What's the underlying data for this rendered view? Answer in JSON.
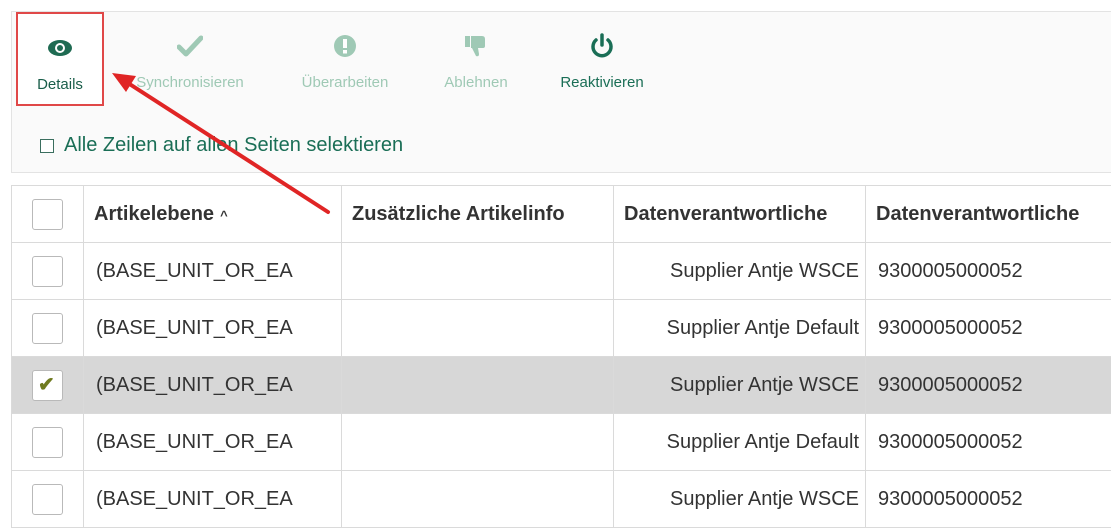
{
  "toolbar": {
    "buttons": [
      {
        "label": "Details",
        "icon": "eye-icon",
        "state": "active"
      },
      {
        "label": "Synchronisieren",
        "icon": "checkmark-icon",
        "state": "disabled"
      },
      {
        "label": "Überarbeiten",
        "icon": "exclamation-icon",
        "state": "disabled"
      },
      {
        "label": "Ablehnen",
        "icon": "thumbs-down-icon",
        "state": "disabled"
      },
      {
        "label": "Reaktivieren",
        "icon": "power-icon",
        "state": "enabled"
      }
    ]
  },
  "select_all": {
    "label": "Alle Zeilen auf allen Seiten selektieren",
    "checked": false
  },
  "table": {
    "headers": [
      "Artikelebene",
      "Zusätzliche Artikelinfo",
      "Datenverantwortliche",
      "Datenverantwortliche"
    ],
    "sort_indicator": "^",
    "rows": [
      {
        "checked": false,
        "cells": [
          "(BASE_UNIT_OR_EA",
          "",
          "Supplier Antje WSCE",
          "9300005000052"
        ]
      },
      {
        "checked": false,
        "cells": [
          "(BASE_UNIT_OR_EA",
          "",
          "Supplier Antje Default",
          "9300005000052"
        ]
      },
      {
        "checked": true,
        "cells": [
          "(BASE_UNIT_OR_EA",
          "",
          "Supplier Antje WSCE",
          "9300005000052"
        ]
      },
      {
        "checked": false,
        "cells": [
          "(BASE_UNIT_OR_EA",
          "",
          "Supplier Antje Default",
          "9300005000052"
        ]
      },
      {
        "checked": false,
        "cells": [
          "(BASE_UNIT_OR_EA",
          "",
          "Supplier Antje WSCE",
          "9300005000052"
        ]
      }
    ]
  },
  "colors": {
    "accent": "#1a6e56",
    "disabled": "#9fc9b5",
    "highlight_border": "#e04848",
    "selected_row": "#d7d7d7"
  }
}
